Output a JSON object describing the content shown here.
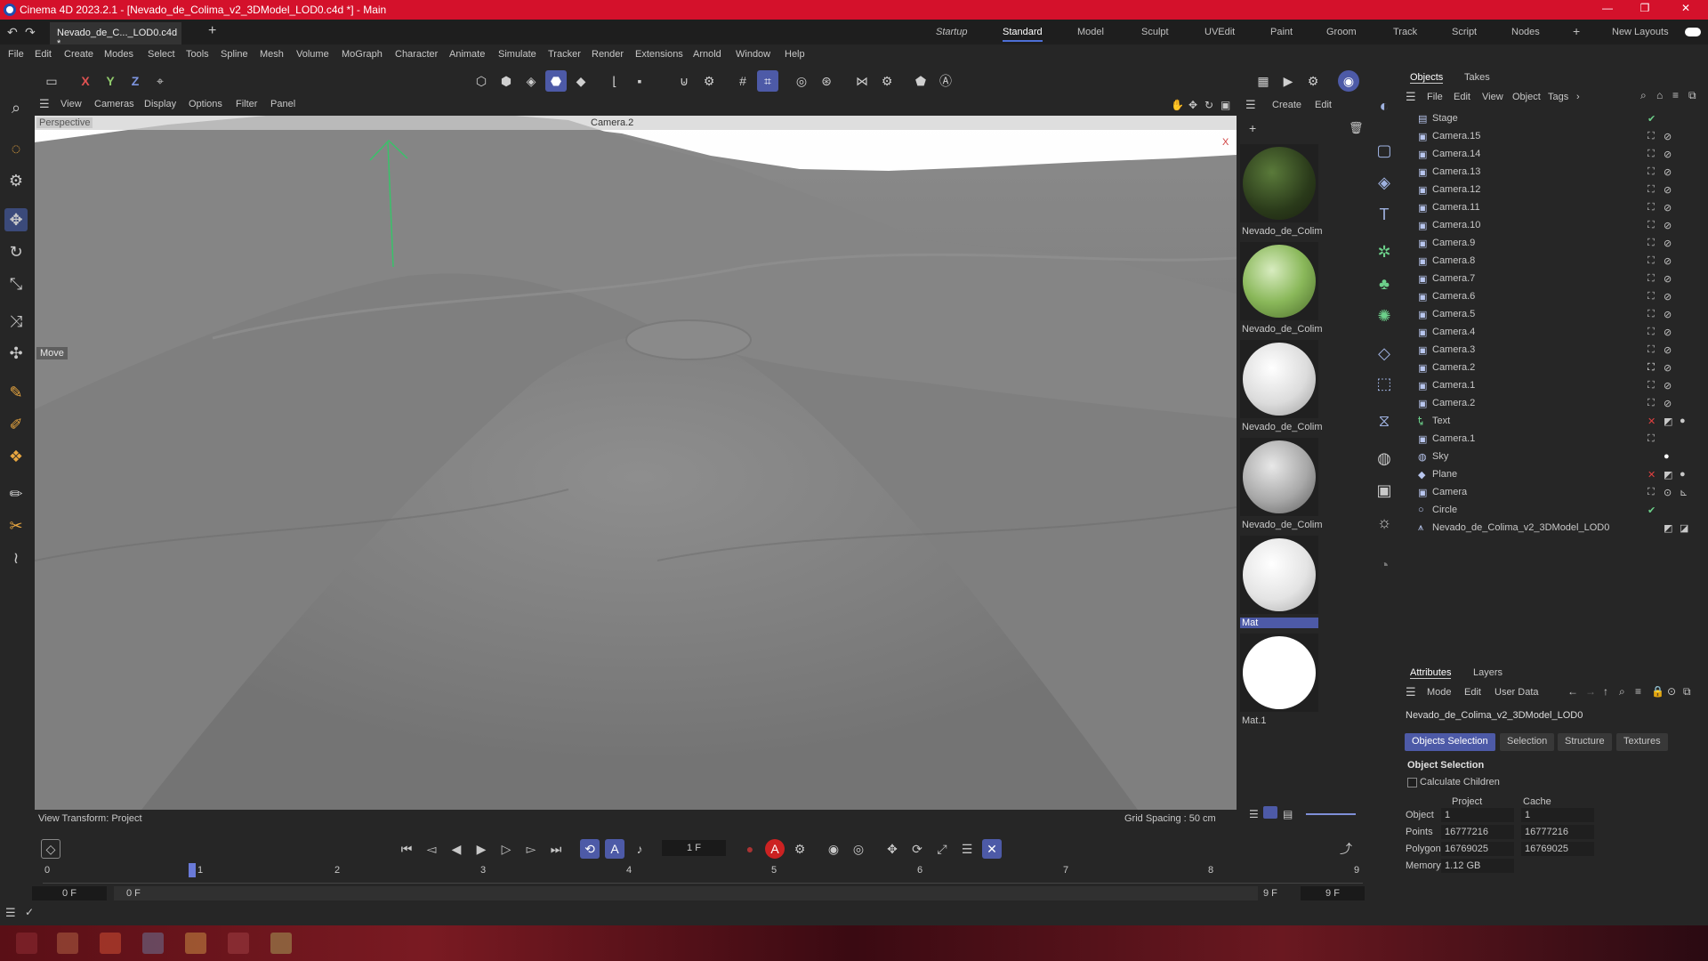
{
  "app": {
    "title": "Cinema 4D 2023.2.1 - [Nevado_de_Colima_v2_3DModel_LOD0.c4d *] - Main",
    "doc_tab": "Nevado_de_C..._LOD0.c4d *"
  },
  "layouts": [
    "Startup",
    "Standard",
    "Model",
    "Sculpt",
    "UVEdit",
    "Paint",
    "Groom",
    "Track",
    "Script",
    "Nodes"
  ],
  "new_layouts": "New Layouts",
  "menu": [
    "File",
    "Edit",
    "Create",
    "Modes",
    "Select",
    "Tools",
    "Spline",
    "Mesh",
    "Volume",
    "MoGraph",
    "Character",
    "Animate",
    "Simulate",
    "Tracker",
    "Render",
    "Extensions",
    "Arnold",
    "Window",
    "Help"
  ],
  "axis": {
    "x": "X",
    "y": "Y",
    "z": "Z"
  },
  "viewport": {
    "menu": [
      "View",
      "Cameras",
      "Display",
      "Options",
      "Filter",
      "Panel"
    ],
    "label": "Perspective",
    "camera": "Camera.2",
    "tool": "Move",
    "view_transform": "View Transform: Project",
    "grid_spacing": "Grid Spacing : 50 cm",
    "axis_x": "X"
  },
  "materials": {
    "menu": [
      "Create",
      "Edit"
    ],
    "items": [
      "Nevado_de_Colim",
      "Nevado_de_Colim",
      "Nevado_de_Colim",
      "Nevado_de_Colim",
      "Mat",
      "Mat.1"
    ]
  },
  "objects": {
    "tabs": [
      "Objects",
      "Takes"
    ],
    "menu": [
      "File",
      "Edit",
      "View",
      "Object",
      "Tags"
    ],
    "rows": [
      "Stage",
      "Camera.15",
      "Camera.14",
      "Camera.13",
      "Camera.12",
      "Camera.11",
      "Camera.10",
      "Camera.9",
      "Camera.8",
      "Camera.7",
      "Camera.6",
      "Camera.5",
      "Camera.4",
      "Camera.3",
      "Camera.2",
      "Camera.1",
      "Camera.2",
      "Text",
      "Camera.1",
      "Sky",
      "Plane",
      "Camera",
      "Circle",
      "Nevado_de_Colima_v2_3DModel_LOD0"
    ]
  },
  "attributes": {
    "tabs": [
      "Attributes",
      "Layers"
    ],
    "menu": [
      "Mode",
      "Edit",
      "User Data"
    ],
    "object_name": "Nevado_de_Colima_v2_3DModel_LOD0",
    "subtabs": [
      "Objects Selection",
      "Selection",
      "Structure",
      "Textures"
    ],
    "section": "Object Selection",
    "checkbox": "Calculate Children",
    "col_project": "Project",
    "col_cache": "Cache",
    "stats": [
      {
        "label": "Object",
        "project": "1",
        "cache": "1"
      },
      {
        "label": "Points",
        "project": "16777216",
        "cache": "16777216"
      },
      {
        "label": "Polygons",
        "project": "16769025",
        "cache": "16769025"
      },
      {
        "label": "Memory",
        "project": "1.12 GB",
        "cache": ""
      }
    ]
  },
  "timeline": {
    "current_frame": "1 F",
    "ticks": [
      "0",
      "1",
      "2",
      "3",
      "4",
      "5",
      "6",
      "7",
      "8",
      "9"
    ],
    "start": "0 F",
    "range_start": "0 F",
    "range_end": "9 F",
    "end": "9 F"
  }
}
